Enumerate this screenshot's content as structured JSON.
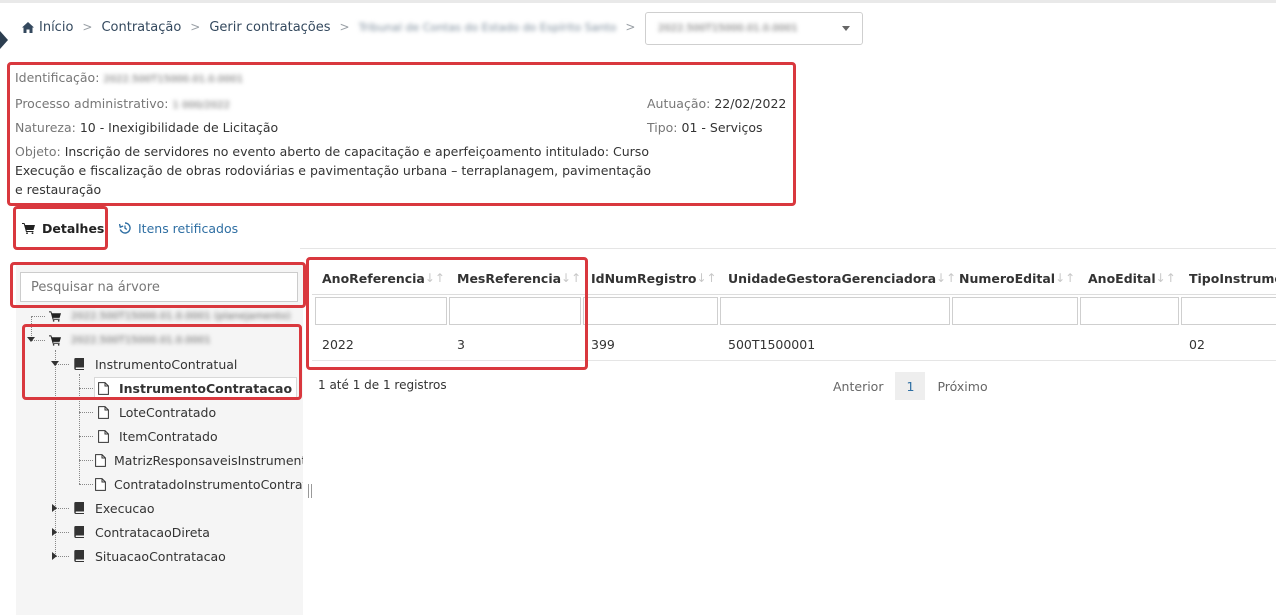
{
  "breadcrumb": {
    "home": "Início",
    "items": [
      "Contratação",
      "Gerir contratações",
      "Tribunal de Contas do Estado do Espírito Santo"
    ]
  },
  "header_select": {
    "value": "2022.500T15000.01.0.0001"
  },
  "info": {
    "identificacao_label": "Identificação:",
    "identificacao_value": "2022.500T15000.01.0.0001",
    "processo_label": "Processo administrativo:",
    "processo_value": "1 000/2022",
    "natureza_label": "Natureza:",
    "natureza_value": "10 - Inexigibilidade de Licitação",
    "objeto_label": "Objeto:",
    "objeto_value": "Inscrição de servidores no evento aberto de capacitação e aperfeiçoamento intitulado: Curso Execução e fiscalização de obras rodoviárias e pavimentação urbana – terraplanagem, pavimentação e restauração",
    "autuacao_label": "Autuação:",
    "autuacao_value": "22/02/2022",
    "tipo_label": "Tipo:",
    "tipo_value": "01 - Serviços"
  },
  "tabs": {
    "detalhes": "Detalhes",
    "itens_retificados": "Itens retificados"
  },
  "tree": {
    "search_placeholder": "Pesquisar na árvore",
    "root1": "2022.500T15000.01.0.0001 (planejamento)",
    "root2": "2022.500T15000.01.0.0001",
    "instrumento_contratual": "InstrumentoContratual",
    "instrumento_contratacao": "InstrumentoContratacao",
    "lote_contratado": "LoteContratado",
    "item_contratado": "ItemContratado",
    "matriz": "MatrizResponsaveisInstrumento",
    "contratado_instrumento": "ContratadoInstrumentoContratacao",
    "execucao": "Execucao",
    "contratacao_direta": "ContratacaoDireta",
    "situacao_contratacao": "SituacaoContratacao"
  },
  "table": {
    "columns": [
      "AnoReferencia",
      "MesReferencia",
      "IdNumRegistro",
      "UnidadeGestoraGerenciadora",
      "NumeroEdital",
      "AnoEdital",
      "TipoInstrumento"
    ],
    "rows": [
      [
        "2022",
        "3",
        "399",
        "500T1500001",
        "",
        "",
        "02"
      ]
    ]
  },
  "pagination": {
    "info": "1 até 1 de 1 registros",
    "previous": "Anterior",
    "current": "1",
    "next": "Próximo"
  },
  "colors": {
    "highlight": "#d9383e",
    "link": "#2f6fa3",
    "nav": "#34495e"
  }
}
